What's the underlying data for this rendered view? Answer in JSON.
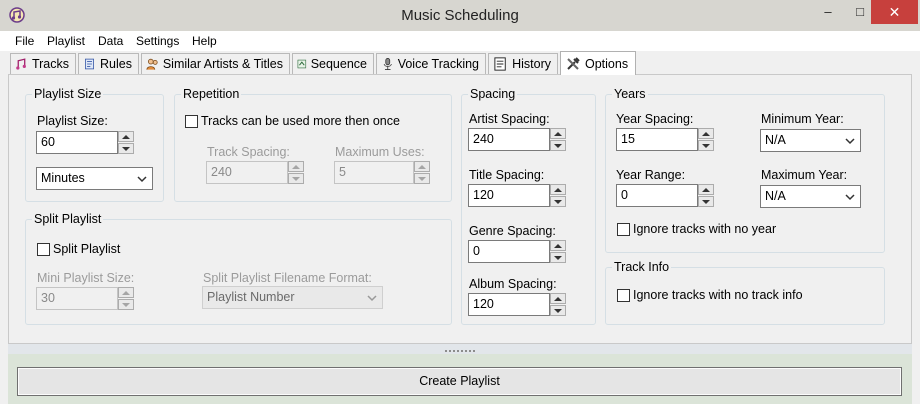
{
  "window": {
    "title": "Music Scheduling"
  },
  "menu": [
    "File",
    "Playlist",
    "Data",
    "Settings",
    "Help"
  ],
  "tabs": [
    "Tracks",
    "Rules",
    "Similar Artists & Titles",
    "Sequence",
    "Voice Tracking",
    "History",
    "Options"
  ],
  "active_tab": "Options",
  "playlist_size": {
    "title": "Playlist Size",
    "label": "Playlist Size:",
    "value": "60",
    "unit": "Minutes"
  },
  "repetition": {
    "title": "Repetition",
    "checkbox_label": "Tracks can be used more then once",
    "checked": false,
    "track_spacing_label": "Track Spacing:",
    "track_spacing_value": "240",
    "max_uses_label": "Maximum Uses:",
    "max_uses_value": "5"
  },
  "split_playlist": {
    "title": "Split Playlist",
    "checkbox_label": "Split Playlist",
    "checked": false,
    "mini_size_label": "Mini Playlist Size:",
    "mini_size_value": "30",
    "format_label": "Split Playlist Filename Format:",
    "format_value": "Playlist Number"
  },
  "spacing": {
    "title": "Spacing",
    "artist_label": "Artist Spacing:",
    "artist_value": "240",
    "title_label": "Title Spacing:",
    "title_value": "120",
    "genre_label": "Genre Spacing:",
    "genre_value": "0",
    "album_label": "Album Spacing:",
    "album_value": "120"
  },
  "years": {
    "title": "Years",
    "year_spacing_label": "Year Spacing:",
    "year_spacing_value": "15",
    "year_range_label": "Year Range:",
    "year_range_value": "0",
    "min_year_label": "Minimum Year:",
    "min_year_value": "N/A",
    "max_year_label": "Maximum Year:",
    "max_year_value": "N/A",
    "ignore_label": "Ignore tracks with no year",
    "ignore_checked": false
  },
  "track_info": {
    "title": "Track Info",
    "ignore_label": "Ignore tracks with no track info",
    "ignore_checked": false
  },
  "create_button": "Create Playlist",
  "colors": {
    "titlebar": "#d7d6d0",
    "close": "#c7403d",
    "bottom_panel": "#dbe4d8"
  }
}
